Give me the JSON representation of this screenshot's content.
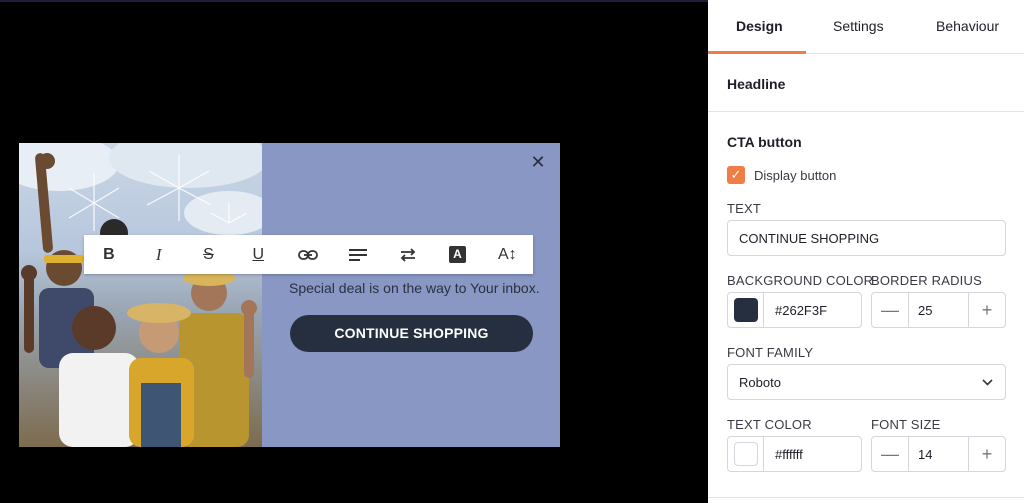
{
  "canvas": {
    "subtext": "Special deal is on the way to Your inbox.",
    "cta_label": "CONTINUE SHOPPING",
    "close_glyph": "✕",
    "popup_bg": "#8897C3"
  },
  "toolbar": {
    "bold": "B",
    "italic": "I",
    "strike": "S",
    "underline": "U",
    "font_color_glyph": "A",
    "font_size_glyph": "A↕"
  },
  "panel": {
    "tabs": [
      {
        "label": "Design"
      },
      {
        "label": "Settings"
      },
      {
        "label": "Behaviour"
      }
    ],
    "headline_section": "Headline",
    "cta_section": "CTA button",
    "display_button_label": "Display button",
    "display_button_checked": true,
    "text_label": "TEXT",
    "text_value": "CONTINUE SHOPPING",
    "bg_color_label": "BACKGROUND COLOR",
    "bg_color_value": "#262F3F",
    "border_radius_label": "BORDER RADIUS",
    "border_radius_value": "25",
    "font_family_label": "FONT FAMILY",
    "font_family_value": "Roboto",
    "text_color_label": "TEXT COLOR",
    "text_color_value": "#ffffff",
    "font_size_label": "FONT SIZE",
    "font_size_value": "14",
    "minus": "—",
    "plus": "+",
    "accent": "#EE7D46"
  }
}
